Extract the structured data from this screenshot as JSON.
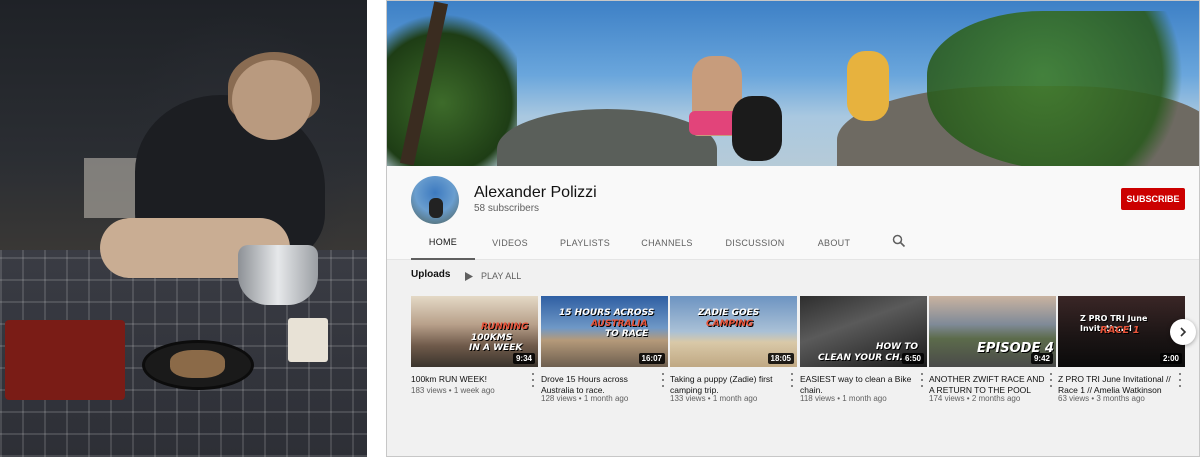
{
  "channel": {
    "name": "Alexander Polizzi",
    "subscribers": "58 subscribers",
    "subscribe_label": "SUBSCRIBE"
  },
  "tabs": [
    {
      "label": "HOME",
      "active": true
    },
    {
      "label": "VIDEOS",
      "active": false
    },
    {
      "label": "PLAYLISTS",
      "active": false
    },
    {
      "label": "CHANNELS",
      "active": false
    },
    {
      "label": "DISCUSSION",
      "active": false
    },
    {
      "label": "ABOUT",
      "active": false
    }
  ],
  "uploads": {
    "title": "Uploads",
    "play_all": "PLAY ALL"
  },
  "videos": [
    {
      "title": "100km RUN WEEK!",
      "meta": "183 views • 1 week ago",
      "duration": "9:34",
      "thumb_text": [
        "RUNNING",
        "100KMS",
        "IN A WEEK"
      ]
    },
    {
      "title": "Drove 15 Hours across Australia to race.",
      "meta": "128 views • 1 month ago",
      "duration": "16:07",
      "thumb_text": [
        "15 HOURS ACROSS",
        "AUSTRALIA",
        "TO RACE"
      ]
    },
    {
      "title": "Taking a puppy (Zadie) first camping trip.",
      "meta": "133 views • 1 month ago",
      "duration": "18:05",
      "thumb_text": [
        "ZADIE GOES",
        "CAMPING"
      ]
    },
    {
      "title": "EASIEST way to clean a Bike chain.",
      "meta": "118 views • 1 month ago",
      "duration": "6:50",
      "thumb_text": [
        "HOW TO",
        "CLEAN YOUR CH..."
      ]
    },
    {
      "title": "ANOTHER ZWIFT RACE AND A RETURN TO THE POOL",
      "meta": "174 views • 2 months ago",
      "duration": "9:42",
      "thumb_text": [
        "EPISODE 4"
      ]
    },
    {
      "title": "Z PRO TRI June Invitational // Race 1 // Amelia Watkinson",
      "meta": "63 views • 3 months ago",
      "duration": "2:00",
      "thumb_text": [
        "Z PRO TRI June Invitational",
        "RACE 1"
      ]
    }
  ],
  "colors": {
    "subscribe_red": "#cc0000",
    "text_primary": "#111111",
    "text_secondary": "#606060",
    "page_bg": "#f1f1f1"
  },
  "icons": [
    "search-icon",
    "play-icon",
    "more-vert-icon",
    "chevron-right-icon"
  ]
}
